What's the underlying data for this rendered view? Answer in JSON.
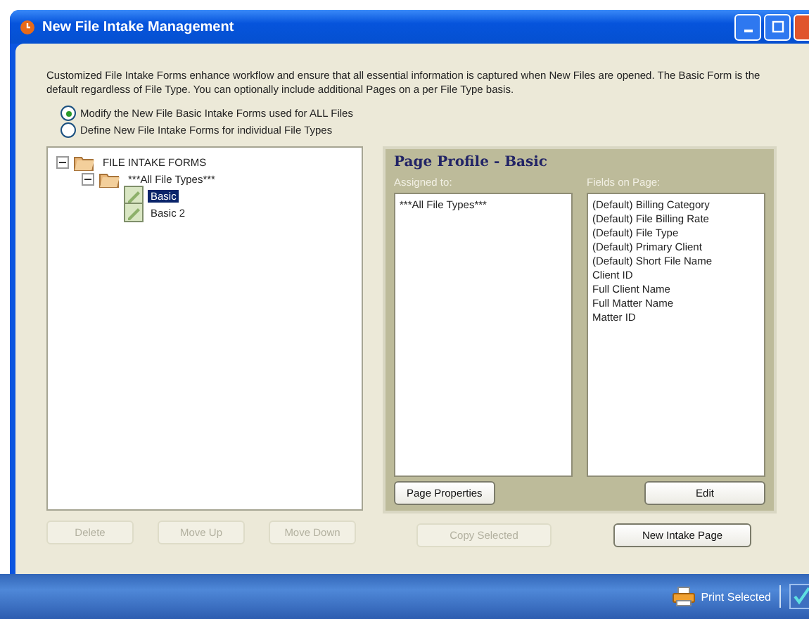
{
  "window": {
    "title": "New File Intake Management"
  },
  "description": "Customized File Intake Forms enhance workflow and ensure that all essential information is captured when New Files are opened. The Basic Form is the default regardless of File Type. You can optionally include additional Pages on a per File Type basis.",
  "modes": [
    {
      "label": "Modify the New File Basic Intake Forms used for ALL Files",
      "selected": true
    },
    {
      "label": "Define New File Intake Forms for individual File Types",
      "selected": false
    }
  ],
  "tree": [
    {
      "label": "FILE INTAKE FORMS",
      "kind": "folder",
      "expanded": true,
      "selected": false,
      "children": [
        {
          "label": "***All File Types***",
          "kind": "folder",
          "expanded": true,
          "selected": false,
          "children": [
            {
              "label": "Basic",
              "kind": "page",
              "selected": true
            },
            {
              "label": "Basic 2",
              "kind": "page",
              "selected": false
            }
          ]
        }
      ]
    }
  ],
  "tree_buttons": [
    {
      "label": "Delete",
      "disabled": true
    },
    {
      "label": "Move Up",
      "disabled": true
    },
    {
      "label": "Move Down",
      "disabled": true
    }
  ],
  "profile": {
    "title": "Page Profile - Basic",
    "assigned_label": "Assigned to:",
    "assigned": [
      "***All File Types***"
    ],
    "fields_label": "Fields on Page:",
    "fields": [
      "(Default) Billing Category",
      "(Default) File Billing Rate",
      "(Default) File Type",
      "(Default) Primary Client",
      "(Default) Short File Name",
      "Client ID",
      "Full Client Name",
      "Full Matter Name",
      "Matter ID"
    ],
    "properties_button": "Page Properties",
    "edit_button": "Edit"
  },
  "copy_button": {
    "label": "Copy Selected",
    "disabled": true
  },
  "new_button": {
    "label": "New Intake Page",
    "disabled": false
  },
  "taskbar": {
    "print": "Print Selected"
  }
}
